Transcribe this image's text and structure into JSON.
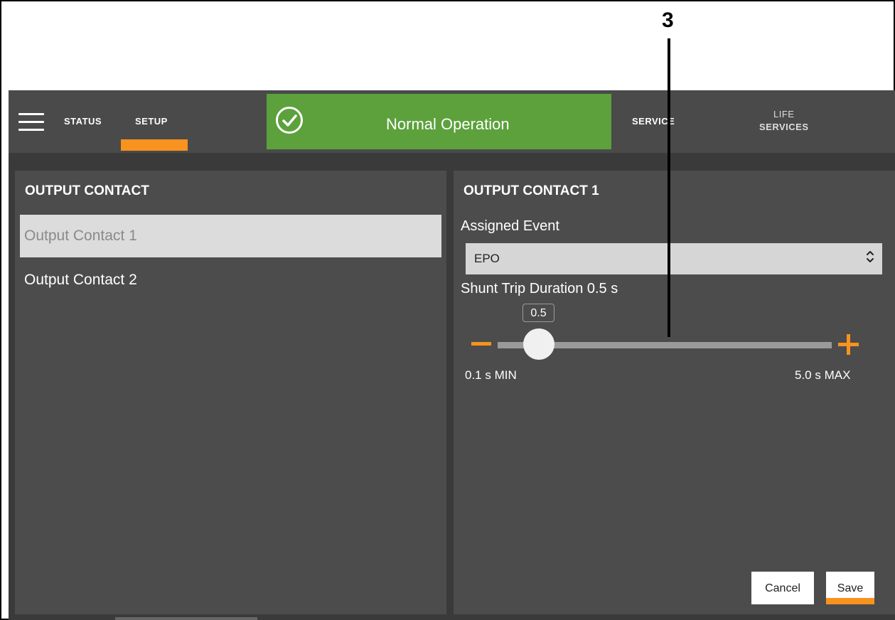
{
  "annotation": {
    "number": "3"
  },
  "nav": {
    "status_label": "STATUS",
    "setup_label": "SETUP",
    "service_label": "SERVICE",
    "life_services_line1": "LIFE",
    "life_services_line2": "SERVICES"
  },
  "status_banner": {
    "text": "Normal Operation",
    "icon": "check-circle-icon",
    "color": "#5ca13c"
  },
  "left_panel": {
    "title": "OUTPUT CONTACT",
    "items": [
      {
        "label": "Output Contact 1",
        "selected": true
      },
      {
        "label": "Output Contact 2",
        "selected": false
      }
    ]
  },
  "right_panel": {
    "title": "OUTPUT CONTACT 1",
    "assigned_event_label": "Assigned Event",
    "assigned_event_value": "EPO",
    "duration_label": "Shunt Trip Duration 0.5 s",
    "slider": {
      "value": 0.5,
      "value_text": "0.5",
      "min": 0.1,
      "max": 5.0,
      "min_label": "0.1 s MIN",
      "max_label": "5.0 s MAX"
    },
    "cancel_label": "Cancel",
    "save_label": "Save"
  },
  "colors": {
    "accent": "#f7931e",
    "panel": "#4c4c4c",
    "topbar": "#4a4a4a"
  }
}
